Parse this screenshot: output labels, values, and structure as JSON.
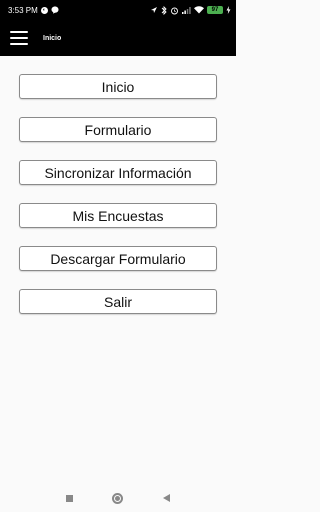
{
  "status_bar": {
    "time": "3:53 PM",
    "battery": "97",
    "left_icons": [
      "ring-icon",
      "messenger-icon"
    ],
    "right_icons": [
      "location-icon",
      "bluetooth-icon",
      "alarm-icon",
      "signal-icon",
      "wifi-icon",
      "battery-icon",
      "charging-icon"
    ]
  },
  "app_bar": {
    "menu_icon": "hamburger-menu-icon",
    "title": "Inicio"
  },
  "menu": {
    "items": [
      {
        "label": "Inicio"
      },
      {
        "label": "Formulario"
      },
      {
        "label": "Sincronizar Información"
      },
      {
        "label": "Mis Encuestas"
      },
      {
        "label": "Descargar Formulario"
      },
      {
        "label": "Salir"
      }
    ]
  },
  "nav_bar": {
    "icons": [
      "recent-apps-icon",
      "home-icon",
      "back-icon"
    ]
  }
}
